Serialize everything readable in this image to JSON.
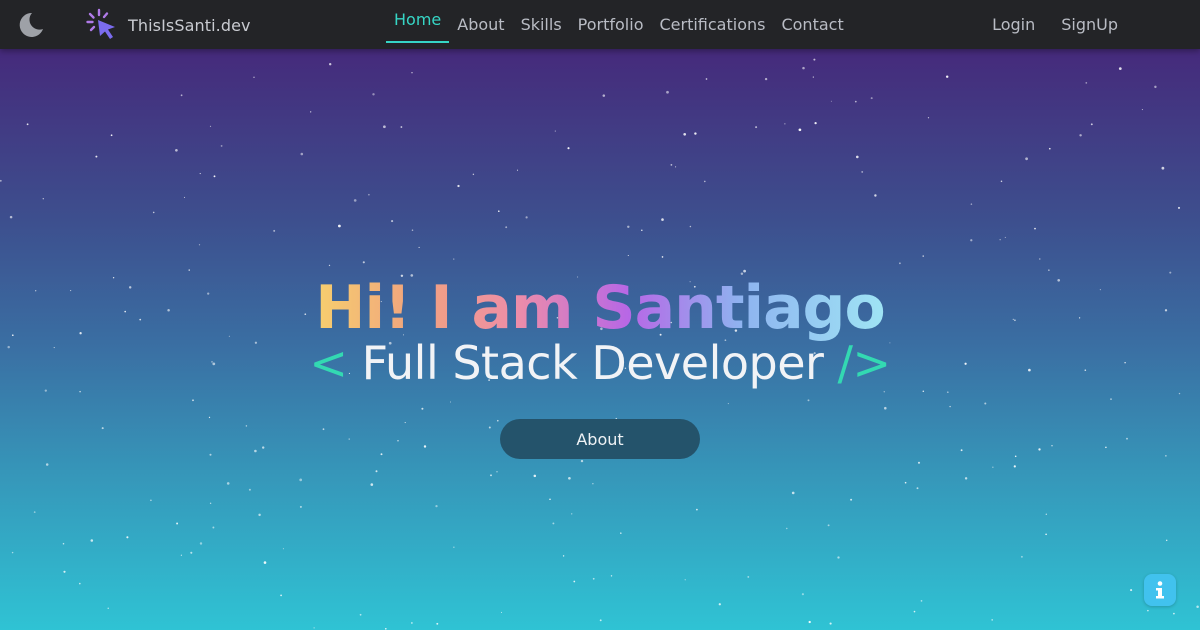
{
  "colors": {
    "navbar_bg": "#232427",
    "accent": "#36d6c6",
    "bracket": "#33d9b2",
    "button_bg": "#24536b",
    "info_bg": "#41c2ee"
  },
  "navbar": {
    "theme_icon": "moon-icon",
    "brand_icon": "cursor-click-icon",
    "brand": "ThisIsSanti.dev",
    "links": [
      {
        "label": "Home",
        "active": true
      },
      {
        "label": "About"
      },
      {
        "label": "Skills"
      },
      {
        "label": "Portfolio"
      },
      {
        "label": "Certifications"
      },
      {
        "label": "Contact"
      }
    ],
    "login": "Login",
    "signup": "SignUp"
  },
  "hero": {
    "title": "Hi! I am Santiago",
    "subtitle_open": "<",
    "subtitle_text": "Full Stack Developer",
    "subtitle_close": "/>",
    "button": "About"
  },
  "info_icon": "info-icon"
}
